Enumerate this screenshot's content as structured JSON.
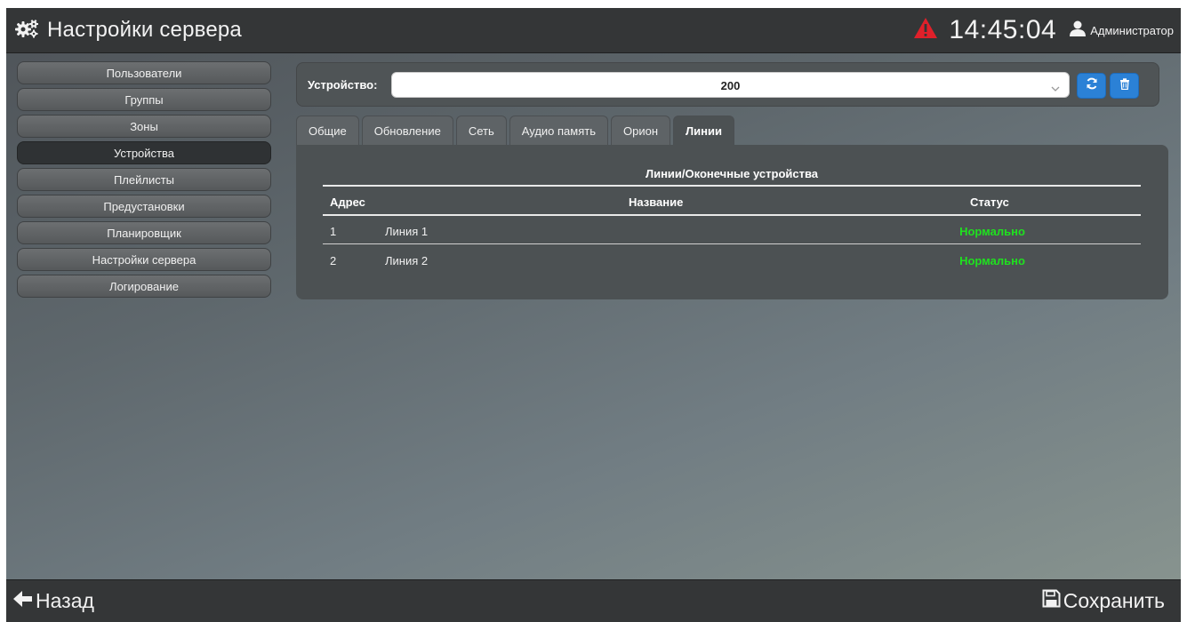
{
  "header": {
    "title": "Настройки сервера",
    "time": "14:45:04",
    "user": "Администратор",
    "alert_color": "#e0202a"
  },
  "sidebar": {
    "items": [
      {
        "label": "Пользователи"
      },
      {
        "label": "Группы"
      },
      {
        "label": "Зоны"
      },
      {
        "label": "Устройства",
        "active": true
      },
      {
        "label": "Плейлисты"
      },
      {
        "label": "Предустановки"
      },
      {
        "label": "Планировщик"
      },
      {
        "label": "Настройки сервера"
      },
      {
        "label": "Логирование"
      }
    ]
  },
  "device": {
    "label": "Устройство:",
    "selected": "200"
  },
  "tabs": [
    {
      "label": "Общие"
    },
    {
      "label": "Обновление"
    },
    {
      "label": "Сеть"
    },
    {
      "label": "Аудио память"
    },
    {
      "label": "Орион"
    },
    {
      "label": "Линии",
      "active": true
    }
  ],
  "lines_table": {
    "caption": "Линии/Оконечные устройства",
    "columns": {
      "address": "Адрес",
      "name": "Название",
      "status": "Статус"
    },
    "rows": [
      {
        "address": "1",
        "name": "Линия 1",
        "status": "Нормально"
      },
      {
        "address": "2",
        "name": "Линия 2",
        "status": "Нормально"
      }
    ],
    "status_color": "#1fe11f"
  },
  "footer": {
    "back_label": "Назад",
    "save_label": "Сохранить"
  }
}
